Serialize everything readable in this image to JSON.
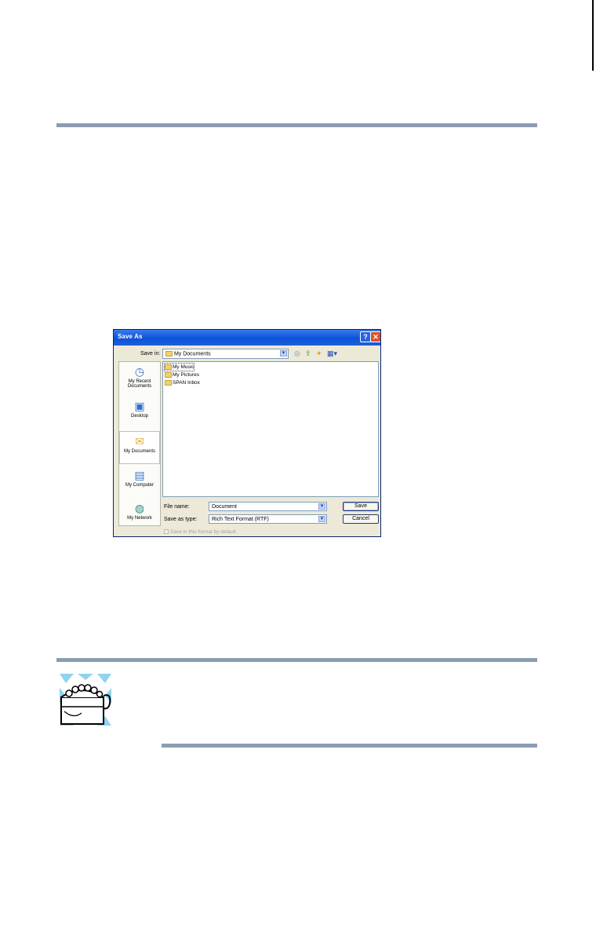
{
  "dialog": {
    "title": "Save As",
    "help_glyph": "?",
    "close_glyph": "✕",
    "save_in_label": "Save in:",
    "save_in_value": "My Documents",
    "places": [
      {
        "label": "My Recent Documents",
        "icon": "recent-documents-icon"
      },
      {
        "label": "Desktop",
        "icon": "desktop-icon"
      },
      {
        "label": "My Documents",
        "icon": "my-documents-icon"
      },
      {
        "label": "My Computer",
        "icon": "my-computer-icon"
      },
      {
        "label": "My Network",
        "icon": "my-network-icon"
      }
    ],
    "files": [
      {
        "name": "My Music"
      },
      {
        "name": "My Pictures"
      },
      {
        "name": "SPAN Inbox"
      }
    ],
    "file_name_label": "File name:",
    "file_name_value": "Document",
    "save_as_type_label": "Save as type:",
    "save_as_type_value": "Rich Text Format (RTF)",
    "save_button": "Save",
    "cancel_button": "Cancel",
    "default_format_checkbox": "Save in this format by default"
  }
}
